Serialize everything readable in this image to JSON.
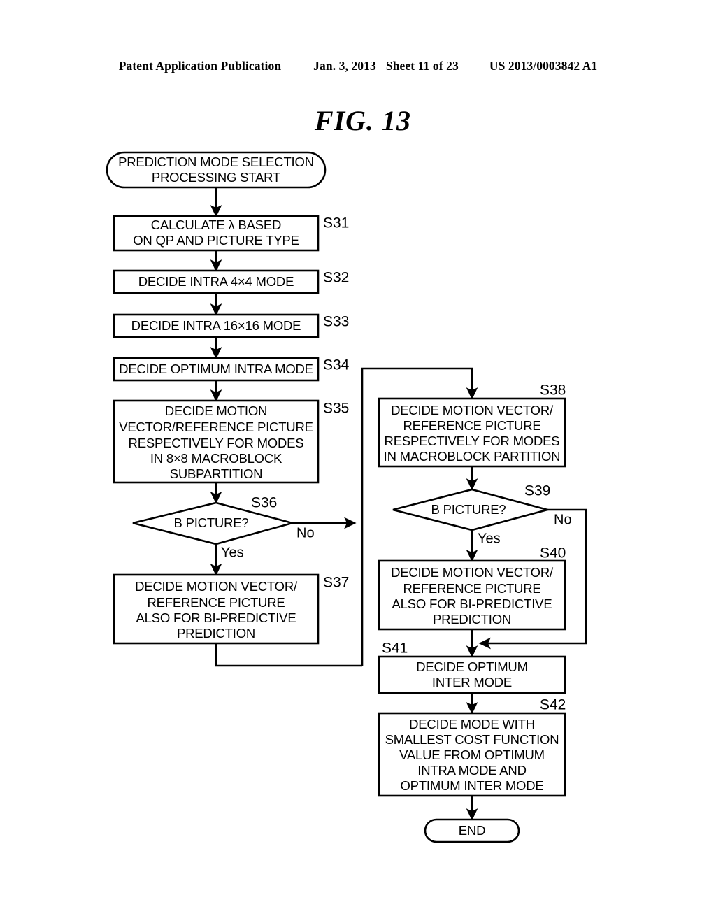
{
  "header": {
    "publication": "Patent Application Publication",
    "date": "Jan. 3, 2013",
    "sheet": "Sheet 11 of 23",
    "document_number": "US 2013/0003842 A1"
  },
  "figure": {
    "title": "FIG. 13"
  },
  "flowchart": {
    "start": {
      "label_line1": "PREDICTION MODE SELECTION",
      "label_line2": "PROCESSING START"
    },
    "end": {
      "label": "END"
    },
    "steps": [
      {
        "id": "S31",
        "tag": "S31",
        "lines": [
          "CALCULATE λ BASED",
          "ON QP AND PICTURE TYPE"
        ]
      },
      {
        "id": "S32",
        "tag": "S32",
        "lines": [
          "DECIDE INTRA 4×4 MODE"
        ]
      },
      {
        "id": "S33",
        "tag": "S33",
        "lines": [
          "DECIDE INTRA 16×16 MODE"
        ]
      },
      {
        "id": "S34",
        "tag": "S34",
        "lines": [
          "DECIDE OPTIMUM INTRA MODE"
        ]
      },
      {
        "id": "S35",
        "tag": "S35",
        "lines": [
          "DECIDE MOTION",
          "VECTOR/REFERENCE PICTURE",
          "RESPECTIVELY FOR MODES",
          "IN 8×8 MACROBLOCK",
          "SUBPARTITION"
        ]
      },
      {
        "id": "S36",
        "tag": "S36",
        "lines": [
          "B PICTURE?"
        ],
        "yes_label": "Yes",
        "no_label": "No"
      },
      {
        "id": "S37",
        "tag": "S37",
        "lines": [
          "DECIDE MOTION VECTOR/",
          "REFERENCE PICTURE",
          "ALSO FOR BI-PREDICTIVE",
          "PREDICTION"
        ]
      },
      {
        "id": "S38",
        "tag": "S38",
        "lines": [
          "DECIDE MOTION VECTOR/",
          "REFERENCE PICTURE",
          "RESPECTIVELY FOR MODES",
          "IN MACROBLOCK PARTITION"
        ]
      },
      {
        "id": "S39",
        "tag": "S39",
        "lines": [
          "B PICTURE?"
        ],
        "yes_label": "Yes",
        "no_label": "No"
      },
      {
        "id": "S40",
        "tag": "S40",
        "lines": [
          "DECIDE MOTION VECTOR/",
          "REFERENCE PICTURE",
          "ALSO FOR BI-PREDICTIVE",
          "PREDICTION"
        ]
      },
      {
        "id": "S41",
        "tag": "S41",
        "lines": [
          "DECIDE OPTIMUM",
          "INTER MODE"
        ]
      },
      {
        "id": "S42",
        "tag": "S42",
        "lines": [
          "DECIDE MODE WITH",
          "SMALLEST COST FUNCTION",
          "VALUE FROM OPTIMUM",
          "INTRA MODE AND",
          "OPTIMUM INTER MODE"
        ]
      }
    ],
    "colors": {
      "ink": "#000000",
      "paper": "#ffffff"
    }
  }
}
